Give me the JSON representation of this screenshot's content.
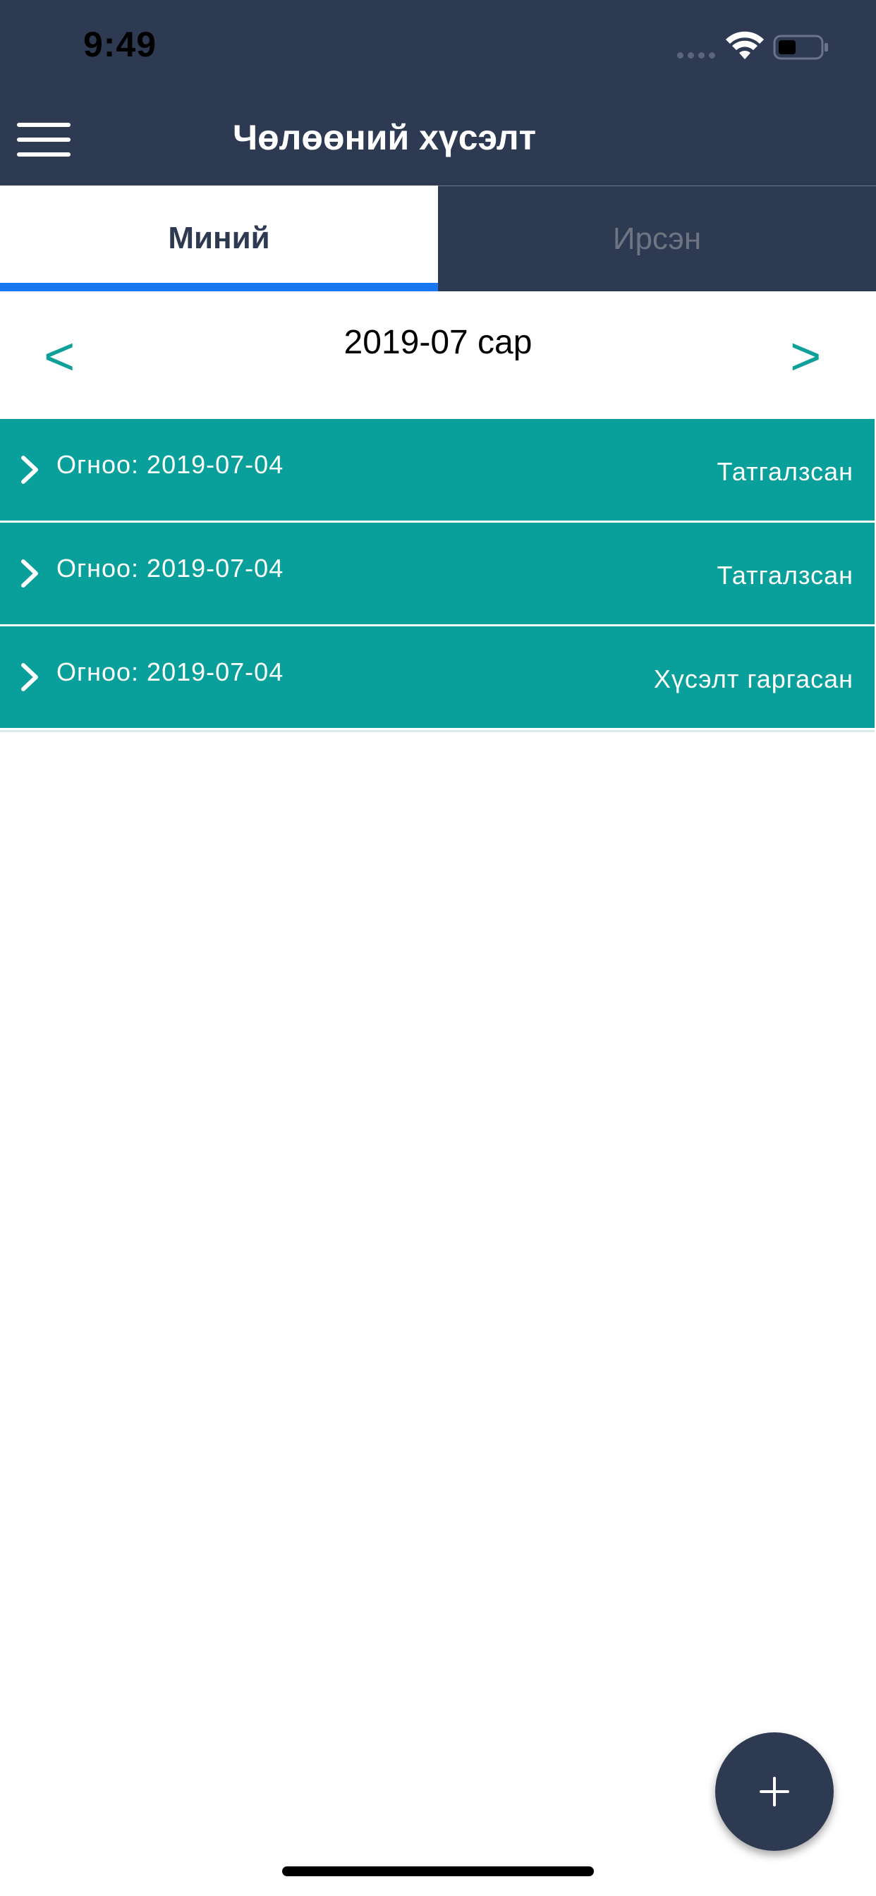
{
  "status_bar": {
    "time": "9:49"
  },
  "header": {
    "title": "Чөлөөний хүсэлт",
    "menu_icon": "hamburger-menu-icon"
  },
  "tabs": [
    {
      "label": "Миний",
      "active": true
    },
    {
      "label": "Ирсэн",
      "active": false
    }
  ],
  "month_nav": {
    "prev_label": "<",
    "current": "2019-07 сар",
    "next_label": ">"
  },
  "requests": [
    {
      "date": "Огноо: 2019-07-04",
      "status": "Татгалзсан"
    },
    {
      "date": "Огноо: 2019-07-04",
      "status": "Татгалзсан"
    },
    {
      "date": "Огноо: 2019-07-04",
      "status": "Хүсэлт гаргасан"
    }
  ],
  "fab": {
    "icon": "plus-icon"
  },
  "colors": {
    "header_bg": "#2e3a52",
    "accent_teal": "#099f9a",
    "tab_underline": "#1877f2",
    "inactive_tab_text": "#6e7482"
  }
}
